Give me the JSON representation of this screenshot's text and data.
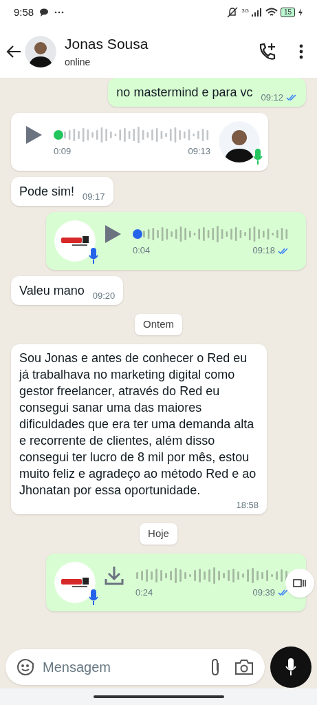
{
  "status_bar": {
    "time": "9:58",
    "network": "3G",
    "battery": "15"
  },
  "header": {
    "name": "Jonas Sousa",
    "status": "online"
  },
  "messages": [
    {
      "kind": "text",
      "outgoing": true,
      "text": "no mastermind e para vc",
      "time": "09:12",
      "read": true
    },
    {
      "kind": "audio",
      "outgoing": false,
      "avatar": {
        "kind": "person"
      },
      "played": false,
      "downloaded": true,
      "duration": "0:09",
      "time": "09:13"
    },
    {
      "kind": "text",
      "outgoing": false,
      "text": "Pode sim!",
      "time": "09:17"
    },
    {
      "kind": "audio",
      "outgoing": true,
      "avatar": {
        "kind": "logo"
      },
      "played": true,
      "downloaded": true,
      "duration": "0:04",
      "time": "09:18",
      "read": true
    },
    {
      "kind": "text",
      "outgoing": false,
      "text": "Valeu mano",
      "time": "09:20"
    },
    {
      "kind": "date",
      "text": "Ontem"
    },
    {
      "kind": "text",
      "outgoing": false,
      "text": "Sou Jonas e antes de conhecer o Red eu já trabalhava no marketing digital como gestor freelancer, através do Red eu consegui sanar uma das maiores dificuldades que era ter uma demanda alta e recorrente de clientes, além disso consegui ter lucro de 8 mil por mês, estou muito feliz e agradeço ao método Red e ao Jhonatan por essa oportunidade.",
      "time": "18:58"
    },
    {
      "kind": "date",
      "text": "Hoje"
    },
    {
      "kind": "audio",
      "outgoing": true,
      "avatar": {
        "kind": "logo"
      },
      "downloaded": false,
      "duration": "0:24",
      "time": "09:39",
      "read": true
    }
  ],
  "composer": {
    "placeholder": "Mensagem"
  }
}
